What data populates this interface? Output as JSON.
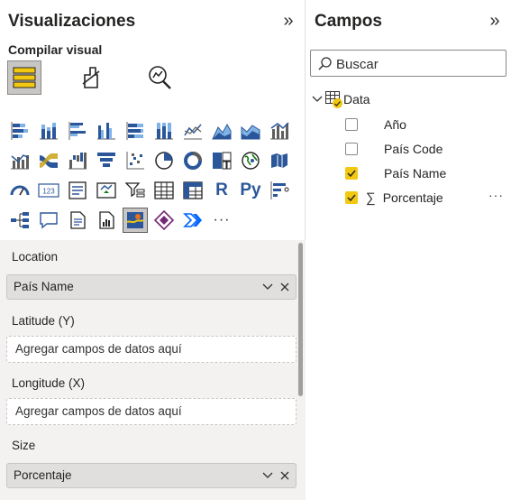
{
  "visualizations": {
    "title": "Visualizaciones",
    "subtitle": "Compilar visual",
    "collapse_glyph": "»",
    "tabs": [
      {
        "icon": "build-visual-icon",
        "active": true
      },
      {
        "icon": "format-visual-icon",
        "active": false
      },
      {
        "icon": "analytics-icon",
        "active": false
      }
    ],
    "grid_icons": [
      "stacked-bar-chart-icon",
      "stacked-column-chart-icon",
      "clustered-bar-chart-icon",
      "clustered-column-chart-icon",
      "100-stacked-bar-chart-icon",
      "100-stacked-column-chart-icon",
      "line-chart-icon",
      "area-chart-icon",
      "stacked-area-chart-icon",
      "line-clustered-column-chart-icon",
      "line-stacked-column-chart-icon",
      "ribbon-chart-icon",
      "waterfall-chart-icon",
      "funnel-chart-icon",
      "scatter-chart-icon",
      "pie-chart-icon",
      "donut-chart-icon",
      "treemap-icon",
      "map-icon",
      "filled-map-icon",
      "gauge-icon",
      "card-icon",
      "multi-row-card-icon",
      "kpi-icon",
      "slicer-icon",
      "table-icon",
      "matrix-icon",
      "r-script-icon",
      "python-visual-icon",
      "key-influencers-icon",
      "decomposition-tree-icon",
      "qa-icon",
      "smart-narrative-icon",
      "paginated-report-icon",
      "azure-map-icon",
      "power-apps-icon",
      "power-automate-icon",
      "more-visuals-icon"
    ],
    "text_icons": {
      "r": "R",
      "py": "Py",
      "more": "···"
    },
    "selected_icon": "azure-map-icon",
    "wells": {
      "location": {
        "label": "Location",
        "value": "País Name"
      },
      "latitude": {
        "label": "Latitude (Y)",
        "placeholder": "Agregar campos de datos aquí"
      },
      "longitude": {
        "label": "Longitude (X)",
        "placeholder": "Agregar campos de datos aquí"
      },
      "size": {
        "label": "Size",
        "value": "Porcentaje"
      }
    }
  },
  "fields": {
    "title": "Campos",
    "collapse_glyph": "»",
    "search_placeholder": "Buscar",
    "table": {
      "name": "Data",
      "items": [
        {
          "label": "Año",
          "checked": false,
          "sigma": false
        },
        {
          "label": "País Code",
          "checked": false,
          "sigma": false
        },
        {
          "label": "País Name",
          "checked": true,
          "sigma": true
        },
        {
          "label": "Porcentaje",
          "checked": true,
          "sigma": true
        }
      ]
    },
    "more_options": "···"
  },
  "colors": {
    "accent_yellow": "#f2c811",
    "icon_blue": "#2b579a",
    "selected_bg": "#c8c6c4"
  }
}
